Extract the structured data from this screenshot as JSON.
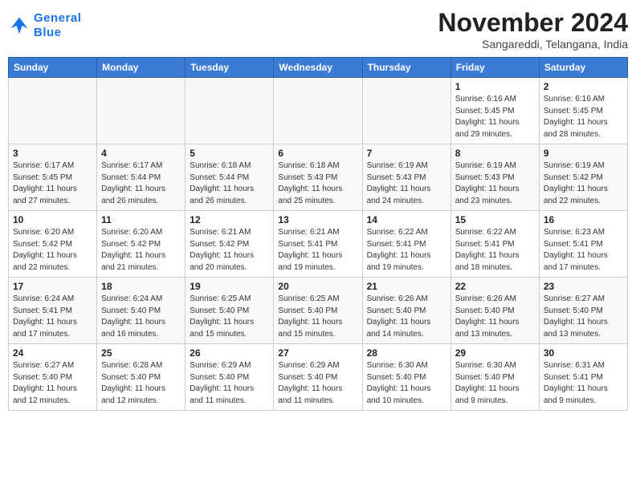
{
  "logo": {
    "line1": "General",
    "line2": "Blue"
  },
  "title": "November 2024",
  "subtitle": "Sangareddi, Telangana, India",
  "weekdays": [
    "Sunday",
    "Monday",
    "Tuesday",
    "Wednesday",
    "Thursday",
    "Friday",
    "Saturday"
  ],
  "weeks": [
    [
      {
        "day": "",
        "info": ""
      },
      {
        "day": "",
        "info": ""
      },
      {
        "day": "",
        "info": ""
      },
      {
        "day": "",
        "info": ""
      },
      {
        "day": "",
        "info": ""
      },
      {
        "day": "1",
        "info": "Sunrise: 6:16 AM\nSunset: 5:45 PM\nDaylight: 11 hours\nand 29 minutes."
      },
      {
        "day": "2",
        "info": "Sunrise: 6:16 AM\nSunset: 5:45 PM\nDaylight: 11 hours\nand 28 minutes."
      }
    ],
    [
      {
        "day": "3",
        "info": "Sunrise: 6:17 AM\nSunset: 5:45 PM\nDaylight: 11 hours\nand 27 minutes."
      },
      {
        "day": "4",
        "info": "Sunrise: 6:17 AM\nSunset: 5:44 PM\nDaylight: 11 hours\nand 26 minutes."
      },
      {
        "day": "5",
        "info": "Sunrise: 6:18 AM\nSunset: 5:44 PM\nDaylight: 11 hours\nand 26 minutes."
      },
      {
        "day": "6",
        "info": "Sunrise: 6:18 AM\nSunset: 5:43 PM\nDaylight: 11 hours\nand 25 minutes."
      },
      {
        "day": "7",
        "info": "Sunrise: 6:19 AM\nSunset: 5:43 PM\nDaylight: 11 hours\nand 24 minutes."
      },
      {
        "day": "8",
        "info": "Sunrise: 6:19 AM\nSunset: 5:43 PM\nDaylight: 11 hours\nand 23 minutes."
      },
      {
        "day": "9",
        "info": "Sunrise: 6:19 AM\nSunset: 5:42 PM\nDaylight: 11 hours\nand 22 minutes."
      }
    ],
    [
      {
        "day": "10",
        "info": "Sunrise: 6:20 AM\nSunset: 5:42 PM\nDaylight: 11 hours\nand 22 minutes."
      },
      {
        "day": "11",
        "info": "Sunrise: 6:20 AM\nSunset: 5:42 PM\nDaylight: 11 hours\nand 21 minutes."
      },
      {
        "day": "12",
        "info": "Sunrise: 6:21 AM\nSunset: 5:42 PM\nDaylight: 11 hours\nand 20 minutes."
      },
      {
        "day": "13",
        "info": "Sunrise: 6:21 AM\nSunset: 5:41 PM\nDaylight: 11 hours\nand 19 minutes."
      },
      {
        "day": "14",
        "info": "Sunrise: 6:22 AM\nSunset: 5:41 PM\nDaylight: 11 hours\nand 19 minutes."
      },
      {
        "day": "15",
        "info": "Sunrise: 6:22 AM\nSunset: 5:41 PM\nDaylight: 11 hours\nand 18 minutes."
      },
      {
        "day": "16",
        "info": "Sunrise: 6:23 AM\nSunset: 5:41 PM\nDaylight: 11 hours\nand 17 minutes."
      }
    ],
    [
      {
        "day": "17",
        "info": "Sunrise: 6:24 AM\nSunset: 5:41 PM\nDaylight: 11 hours\nand 17 minutes."
      },
      {
        "day": "18",
        "info": "Sunrise: 6:24 AM\nSunset: 5:40 PM\nDaylight: 11 hours\nand 16 minutes."
      },
      {
        "day": "19",
        "info": "Sunrise: 6:25 AM\nSunset: 5:40 PM\nDaylight: 11 hours\nand 15 minutes."
      },
      {
        "day": "20",
        "info": "Sunrise: 6:25 AM\nSunset: 5:40 PM\nDaylight: 11 hours\nand 15 minutes."
      },
      {
        "day": "21",
        "info": "Sunrise: 6:26 AM\nSunset: 5:40 PM\nDaylight: 11 hours\nand 14 minutes."
      },
      {
        "day": "22",
        "info": "Sunrise: 6:26 AM\nSunset: 5:40 PM\nDaylight: 11 hours\nand 13 minutes."
      },
      {
        "day": "23",
        "info": "Sunrise: 6:27 AM\nSunset: 5:40 PM\nDaylight: 11 hours\nand 13 minutes."
      }
    ],
    [
      {
        "day": "24",
        "info": "Sunrise: 6:27 AM\nSunset: 5:40 PM\nDaylight: 11 hours\nand 12 minutes."
      },
      {
        "day": "25",
        "info": "Sunrise: 6:28 AM\nSunset: 5:40 PM\nDaylight: 11 hours\nand 12 minutes."
      },
      {
        "day": "26",
        "info": "Sunrise: 6:29 AM\nSunset: 5:40 PM\nDaylight: 11 hours\nand 11 minutes."
      },
      {
        "day": "27",
        "info": "Sunrise: 6:29 AM\nSunset: 5:40 PM\nDaylight: 11 hours\nand 11 minutes."
      },
      {
        "day": "28",
        "info": "Sunrise: 6:30 AM\nSunset: 5:40 PM\nDaylight: 11 hours\nand 10 minutes."
      },
      {
        "day": "29",
        "info": "Sunrise: 6:30 AM\nSunset: 5:40 PM\nDaylight: 11 hours\nand 9 minutes."
      },
      {
        "day": "30",
        "info": "Sunrise: 6:31 AM\nSunset: 5:41 PM\nDaylight: 11 hours\nand 9 minutes."
      }
    ]
  ]
}
